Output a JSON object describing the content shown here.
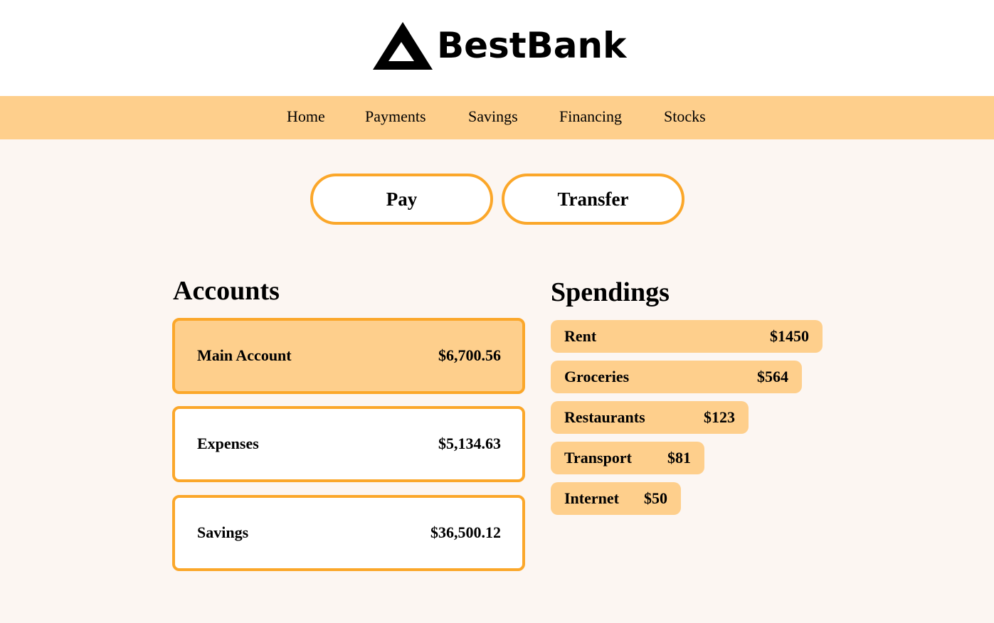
{
  "brand": {
    "name": "BestBank",
    "logo_icon": "triangle-logo-icon"
  },
  "nav": {
    "items": [
      {
        "label": "Home"
      },
      {
        "label": "Payments"
      },
      {
        "label": "Savings"
      },
      {
        "label": "Financing"
      },
      {
        "label": "Stocks"
      }
    ]
  },
  "actions": {
    "pay_label": "Pay",
    "transfer_label": "Transfer"
  },
  "accounts": {
    "title": "Accounts",
    "items": [
      {
        "name": "Main Account",
        "amount": "$6,700.56",
        "selected": true
      },
      {
        "name": "Expenses",
        "amount": "$5,134.63",
        "selected": false
      },
      {
        "name": "Savings",
        "amount": "$36,500.12",
        "selected": false
      }
    ]
  },
  "spendings": {
    "title": "Spendings",
    "items": [
      {
        "name": "Rent",
        "amount": "$1450",
        "value": 1450
      },
      {
        "name": "Groceries",
        "amount": "$564",
        "value": 564
      },
      {
        "name": "Restaurants",
        "amount": "$123",
        "value": 123
      },
      {
        "name": "Transport",
        "amount": "$81",
        "value": 81
      },
      {
        "name": "Internet",
        "amount": "$50",
        "value": 50
      }
    ]
  },
  "colors": {
    "accent": "#fba72a",
    "accent_light": "#fecf8c",
    "page_bg": "#fcf6f2",
    "header_bg": "#ffffff"
  }
}
